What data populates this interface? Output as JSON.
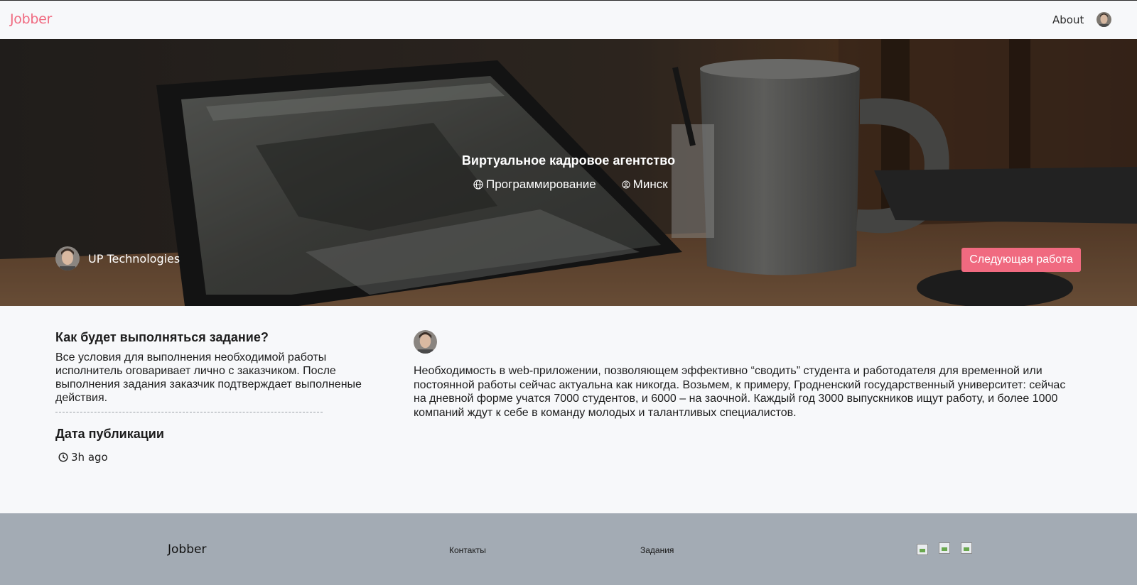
{
  "header": {
    "logo": "Jobber",
    "nav_about": "About"
  },
  "hero": {
    "title": "Виртуальное кадровое агентство",
    "category": "Программирование",
    "city": "Минск",
    "company_name": "UP Technologies",
    "next_button": "Следующая работа"
  },
  "details": {
    "how_title": "Как будет выполняться задание?",
    "how_text": "Все условия для выполнения необходимой работы исполнитель оговаривает лично с заказчиком. После выполнения задания заказчик подтверждает выполненые действия.",
    "pub_title": "Дата публикации",
    "pub_time": "3h ago",
    "description": "Необходимость в web-приложении, позволяющем эффективно “сводить” студента и работодателя для временной или постоянной работы сейчас актуальна как никогда. Возьмем, к примеру, Гродненский государственный университет: сейчас на дневной форме учатся 7000 студентов, и 6000 – на заочной. Каждый год 3000 выпускников ищут работу, и более 1000 компаний ждут к себе в команду молодых и талантливых специалистов."
  },
  "footer": {
    "logo": "Jobber",
    "contacts": "Контакты",
    "tasks": "Задания",
    "social_icons": [
      "social-icon-1",
      "social-icon-2",
      "social-icon-3"
    ]
  },
  "colors": {
    "accent": "#f06a80",
    "footer_bg": "#a3abb4",
    "page_bg": "#f7f8fa"
  }
}
